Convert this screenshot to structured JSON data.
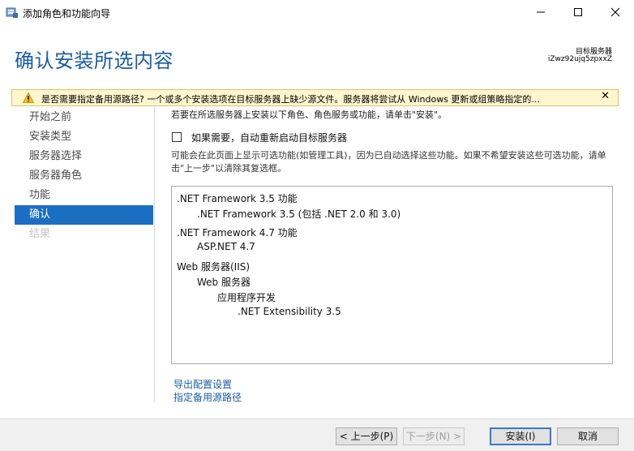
{
  "window": {
    "title": "添加角色和功能向导",
    "min_icon": "minimize-icon",
    "max_icon": "maximize-icon",
    "close_icon": "close-icon"
  },
  "header": {
    "title": "确认安装所选内容",
    "target_label": "目标服务器",
    "target_value": "iZwz92ujq5zpxxZ"
  },
  "warning": {
    "icon": "warning-icon",
    "text": "是否需要指定备用源路径? 一个或多个安装选项在目标服务器上缺少源文件。服务器将尝试从 Windows 更新或组策略指定的...",
    "close_label": "✕"
  },
  "nav": {
    "items": [
      {
        "label": "开始之前",
        "state": "normal"
      },
      {
        "label": "安装类型",
        "state": "normal"
      },
      {
        "label": "服务器选择",
        "state": "normal"
      },
      {
        "label": "服务器角色",
        "state": "normal"
      },
      {
        "label": "功能",
        "state": "normal"
      },
      {
        "label": "确认",
        "state": "active"
      },
      {
        "label": "结果",
        "state": "disabled"
      }
    ]
  },
  "content": {
    "intro": "若要在所选服务器上安装以下角色、角色服务或功能，请单击\"安装\"。",
    "restart_checkbox_label": "如果需要，自动重新启动目标服务器",
    "restart_checked": false,
    "note": "可能会在此页面上显示可选功能(如管理工具)，因为已自动选择这些功能。如果不希望安装这些可选功能，请单击\"上一步\"以清除其复选框。",
    "items": [
      {
        "text": ".NET Framework 3.5 功能",
        "level": 0
      },
      {
        "text": ".NET Framework 3.5 (包括 .NET 2.0 和 3.0)",
        "level": 1
      },
      {
        "text": ".NET Framework 4.7 功能",
        "level": 0
      },
      {
        "text": "ASP.NET 4.7",
        "level": 1
      },
      {
        "text": "Web 服务器(IIS)",
        "level": 0
      },
      {
        "text": "Web 服务器",
        "level": 1
      },
      {
        "text": "应用程序开发",
        "level": 2
      },
      {
        "text": ".NET Extensibility 3.5",
        "level": 3
      }
    ],
    "export_link": "导出配置设置",
    "source_link": "指定备用源路径"
  },
  "footer": {
    "prev": "< 上一步(P)",
    "next": "下一步(N) >",
    "install": "安装(I)",
    "cancel": "取消"
  },
  "colors": {
    "accent": "#1a6fc2",
    "title_blue": "#1a5da5",
    "warning_bg": "#fdf6cf"
  }
}
